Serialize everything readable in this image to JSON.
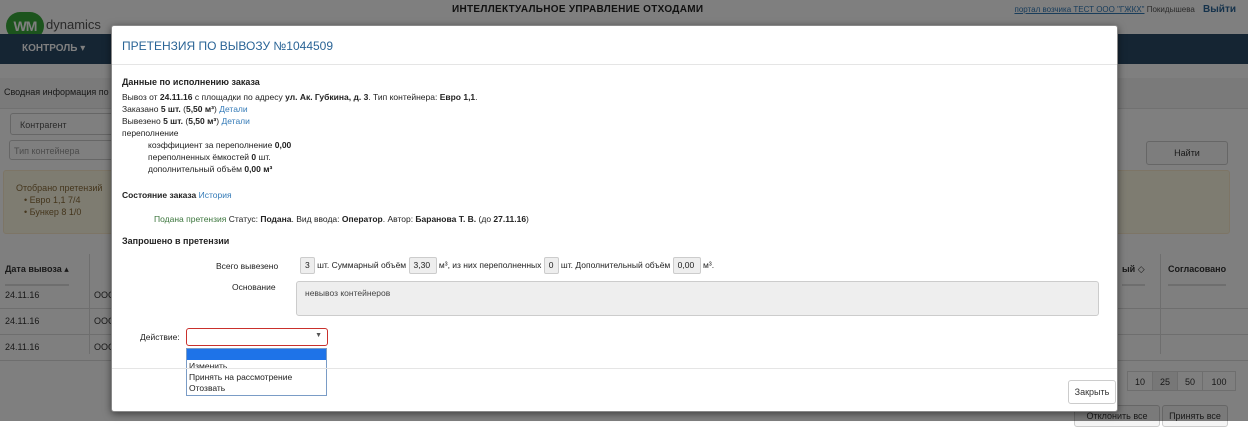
{
  "header": {
    "logo_mark": "WM",
    "logo_text": "dynamics",
    "app_title": "ИНТЕЛЛЕКТУАЛЬНОЕ УПРАВЛЕНИЕ ОТХОДАМИ",
    "portal_link": "портал возчика ТЕСТ ООО \"ГЖКХ\"",
    "user_name": "Покидышева",
    "logout": "Выйти"
  },
  "nav": {
    "control": "КОНТРОЛЬ ▾"
  },
  "summary": {
    "label": "Сводная информация по"
  },
  "filters": {
    "contractor": "Контрагент",
    "container_type_placeholder": "Тип контейнера",
    "find_button": "Найти"
  },
  "alert": {
    "title": "Отобрано претензий",
    "items": [
      "• Евро 1,1 7/4",
      "• Бункер 8 1/0"
    ]
  },
  "table": {
    "headers": {
      "date": "Дата вывоза ▴",
      "right1": "ый ◇",
      "agreed": "Согласовано"
    },
    "rows": [
      {
        "date": "24.11.16",
        "c2": "ООС"
      },
      {
        "date": "24.11.16",
        "c2": "ООС"
      },
      {
        "date": "24.11.16",
        "c2": "ООС"
      }
    ]
  },
  "pager": {
    "sizes": [
      "10",
      "25",
      "50",
      "100"
    ],
    "active": "25"
  },
  "bulk": {
    "reject_all": "Отклонить все",
    "accept_all": "Принять все"
  },
  "modal": {
    "title": "ПРЕТЕНЗИЯ ПО ВЫВОЗУ №1044509",
    "execution": {
      "heading": "Данные по исполнению заказа",
      "line1_a": "Вывоз от ",
      "line1_date": "24.11.16",
      "line1_b": " с площадки по адресу ",
      "line1_addr": "ул. Ак. Губкина, д. 3",
      "line1_c": ". Тип контейнера: ",
      "line1_type": "Евро 1,1",
      "line1_d": ".",
      "ordered_a": "Заказано ",
      "ordered_b": "5 шт.",
      "ordered_c": " (",
      "ordered_d": "5,50 м³",
      "ordered_e": ") ",
      "ordered_link": "Детали",
      "removed_a": "Вывезено ",
      "removed_b": "5 шт.",
      "removed_c": " (",
      "removed_d": "5,50 м³",
      "removed_e": ") ",
      "removed_link": "Детали",
      "overflow_label": "переполнение",
      "coef_label": "коэффициент за переполнение ",
      "coef_value": "0,00",
      "overfilled_label": "переполненных ёмкостей ",
      "overfilled_value": "0",
      "overfilled_unit": " шт.",
      "extra_label": "дополнительный объём ",
      "extra_value": "0,00 м³"
    },
    "status": {
      "heading": "Состояние заказа ",
      "history_link": "История",
      "submitted": "Подана претензия",
      "status_label": " Статус: ",
      "status_value": "Подана",
      "input_label": ". Вид ввода: ",
      "input_value": "Оператор",
      "author_label": ". Автор: ",
      "author_value": "Баранова Т. В.",
      "deadline_a": " (до ",
      "deadline_value": "27.11.16",
      "deadline_b": ")"
    },
    "request": {
      "heading": "Запрошено в претензии",
      "total_label": "Всего вывезено",
      "total_value": "3",
      "total_unit": "шт. Суммарный объём",
      "volume_value": "3,30",
      "volume_unit": "м³, из них переполненных",
      "overfilled_value": "0",
      "overfilled_unit": "шт. Дополнительный объём",
      "extra_value": "0,00",
      "extra_unit": "м³.",
      "basis_label": "Основание",
      "basis_value": "невывоз контейнеров"
    },
    "action": {
      "label": "Действие:",
      "options": [
        "Изменить",
        "Принять на рассмотрение",
        "Отозвать"
      ]
    },
    "close_button": "Закрыть"
  }
}
